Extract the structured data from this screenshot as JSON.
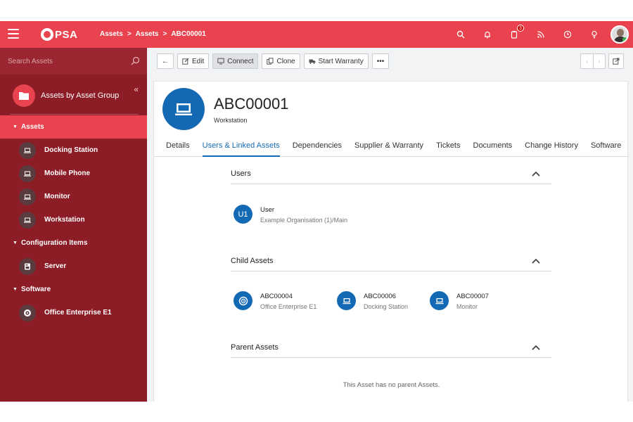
{
  "header": {
    "logo_text": "PSA",
    "breadcrumb": [
      "Assets",
      ">",
      "Assets",
      ">",
      "ABC00001"
    ],
    "notification_count": "3"
  },
  "sidebar": {
    "search_placeholder": "Search Assets",
    "group_title": "Assets by Asset Group",
    "sections": [
      {
        "label": "Assets",
        "items": [
          "Docking Station",
          "Mobile Phone",
          "Monitor",
          "Workstation"
        ]
      },
      {
        "label": "Configuration Items",
        "items": [
          "Server"
        ]
      },
      {
        "label": "Software",
        "items": [
          "Office Enterprise E1"
        ]
      }
    ]
  },
  "toolbar": {
    "edit": "Edit",
    "connect": "Connect",
    "clone": "Clone",
    "start_warranty": "Start Warranty",
    "more": "•••"
  },
  "asset": {
    "id": "ABC00001",
    "type": "Workstation"
  },
  "tabs": [
    "Details",
    "Users & Linked Assets",
    "Dependencies",
    "Supplier & Warranty",
    "Tickets",
    "Documents",
    "Change History",
    "Software"
  ],
  "users_panel": {
    "title": "Users",
    "entries": [
      {
        "initials": "U1",
        "name": "User",
        "org": "Example Organisation (1)/Main"
      }
    ]
  },
  "child_panel": {
    "title": "Child Assets",
    "entries": [
      {
        "id": "ABC00004",
        "type": "Office Enterprise E1",
        "icon": "disc-icon"
      },
      {
        "id": "ABC00006",
        "type": "Docking Station",
        "icon": "laptop-icon"
      },
      {
        "id": "ABC00007",
        "type": "Monitor",
        "icon": "laptop-icon"
      }
    ]
  },
  "parent_panel": {
    "title": "Parent Assets",
    "empty_message": "This Asset has no parent Assets."
  },
  "colors": {
    "brand_red": "#e8434f",
    "sidebar_dark": "#8c1c26",
    "accent_blue": "#1469b5"
  }
}
